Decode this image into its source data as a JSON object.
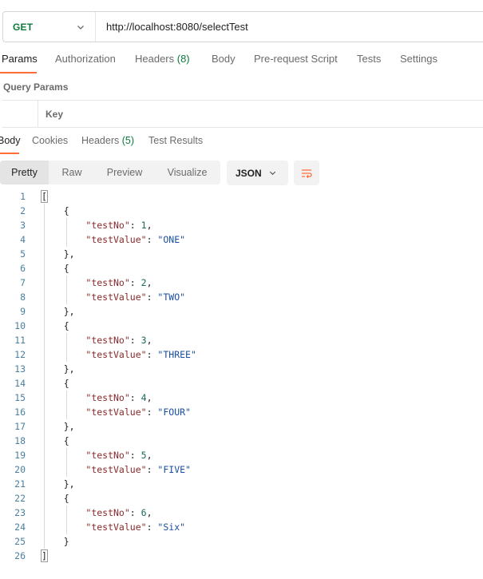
{
  "request": {
    "method": "GET",
    "url": "http://localhost:8080/selectTest"
  },
  "request_tabs": [
    {
      "label": "Params",
      "count": ""
    },
    {
      "label": "Authorization",
      "count": ""
    },
    {
      "label": "Headers ",
      "count": "(8)"
    },
    {
      "label": "Body",
      "count": ""
    },
    {
      "label": "Pre-request Script",
      "count": ""
    },
    {
      "label": "Tests",
      "count": ""
    },
    {
      "label": "Settings",
      "count": ""
    }
  ],
  "query_params": {
    "title": "Query Params",
    "key_header": "Key"
  },
  "response_tabs": [
    {
      "label": "Body",
      "count": ""
    },
    {
      "label": "Cookies",
      "count": ""
    },
    {
      "label": "Headers ",
      "count": "(5)"
    },
    {
      "label": "Test Results",
      "count": ""
    }
  ],
  "format_buttons": [
    "Pretty",
    "Raw",
    "Preview",
    "Visualize"
  ],
  "language": "JSON",
  "response_body": [
    {
      "testNo": 1,
      "testValue": "ONE"
    },
    {
      "testNo": 2,
      "testValue": "TWO"
    },
    {
      "testNo": 3,
      "testValue": "THREE"
    },
    {
      "testNo": 4,
      "testValue": "FOUR"
    },
    {
      "testNo": 5,
      "testValue": "FIVE"
    },
    {
      "testNo": 6,
      "testValue": "Six"
    }
  ],
  "colors": {
    "method_get": "#0c7a3b",
    "accent": "#ff6c37",
    "json_key": "#8a2a2a",
    "json_string": "#1a4fa0",
    "json_number": "#166a5a"
  },
  "icons": {
    "method_dropdown": "chevron-down-icon",
    "language_dropdown": "chevron-down-icon",
    "wrap": "wrap-lines-icon"
  }
}
